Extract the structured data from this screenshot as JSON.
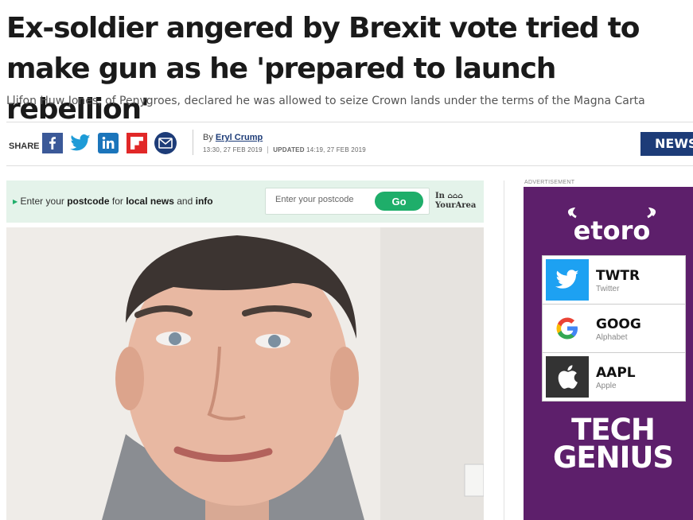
{
  "article": {
    "headline": "Ex-soldier angered by Brexit vote tried to make gun as he 'prepared to launch rebellion'",
    "standfirst": "Llifon Huw Jones, of Penygroes, declared he was allowed to seize Crown lands under the terms of the Magna Carta"
  },
  "share": {
    "label": "SHARE",
    "buttons": [
      "facebook-icon",
      "twitter-icon",
      "linkedin-icon",
      "flipboard-icon",
      "email-icon"
    ]
  },
  "byline": {
    "prefix": "By",
    "author": "Eryl Crump",
    "published": "13:30, 27 FEB 2019",
    "updated_label": "UPDATED",
    "updated": "14:19, 27 FEB 2019"
  },
  "section_tag": "NEWS",
  "postcode": {
    "text_1": "Enter your ",
    "text_bold_1": "postcode",
    "text_2": " for ",
    "text_bold_2": "local news",
    "text_3": " and ",
    "text_bold_3": "info",
    "placeholder": "Enter your postcode",
    "button": "Go",
    "brand_line1": "In",
    "brand_line2": "YourArea"
  },
  "advert": {
    "label": "ADVERTISEMENT",
    "brand": "etoro",
    "stocks": [
      {
        "symbol": "TWTR",
        "name": "Twitter"
      },
      {
        "symbol": "GOOG",
        "name": "Alphabet"
      },
      {
        "symbol": "AAPL",
        "name": "Apple"
      }
    ],
    "tagline_1": "TECH",
    "tagline_2": "GENIUS"
  },
  "colors": {
    "brand_blue": "#1d3c78",
    "go_green": "#1fae6a",
    "postcode_bg": "#e4f3ea",
    "ad_purple": "#5d1f6b"
  }
}
